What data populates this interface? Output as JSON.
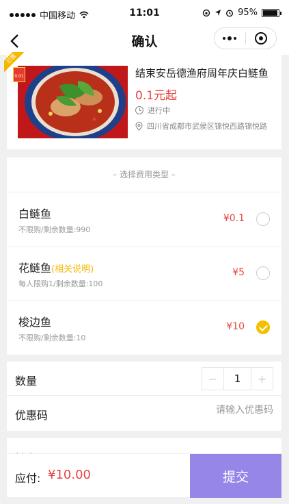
{
  "status_bar": {
    "carrier": "中国移动",
    "time": "11:01",
    "battery": "95%",
    "battery_level": 0.95
  },
  "nav": {
    "title": "确认"
  },
  "product": {
    "badge": "已售",
    "tag": "0.01",
    "title": "结束安岳德渔府周年庆白鲢鱼",
    "price": "0.1元起",
    "status": "进行中",
    "address": "四川省成都市武侯区锦悦西路锦悦路"
  },
  "fee": {
    "header": "– 选择费用类型 –",
    "options": [
      {
        "name": "白鲢鱼",
        "note": "",
        "sub": "不限购/剩余数量:990",
        "price": "¥0.1",
        "selected": false
      },
      {
        "name": "花鲢鱼",
        "note": "(相关说明)",
        "sub": "每人限购1/剩余数量:100",
        "price": "¥5",
        "selected": false
      },
      {
        "name": "梭边鱼",
        "note": "",
        "sub": "不限购/剩余数量:10",
        "price": "¥10",
        "selected": true
      }
    ]
  },
  "form": {
    "quantity_label": "数量",
    "quantity_minus": "−",
    "quantity_value": "1",
    "quantity_plus": "+",
    "coupon_label": "优惠码",
    "coupon_placeholder": "请输入优惠码",
    "remark_label": "姓名"
  },
  "footer": {
    "pay_label": "应付:",
    "amount": "¥10.00",
    "submit": "提交"
  },
  "colors": {
    "price_red": "#e64340",
    "accent_yellow": "#f5c000",
    "submit_purple": "#9686e8"
  }
}
